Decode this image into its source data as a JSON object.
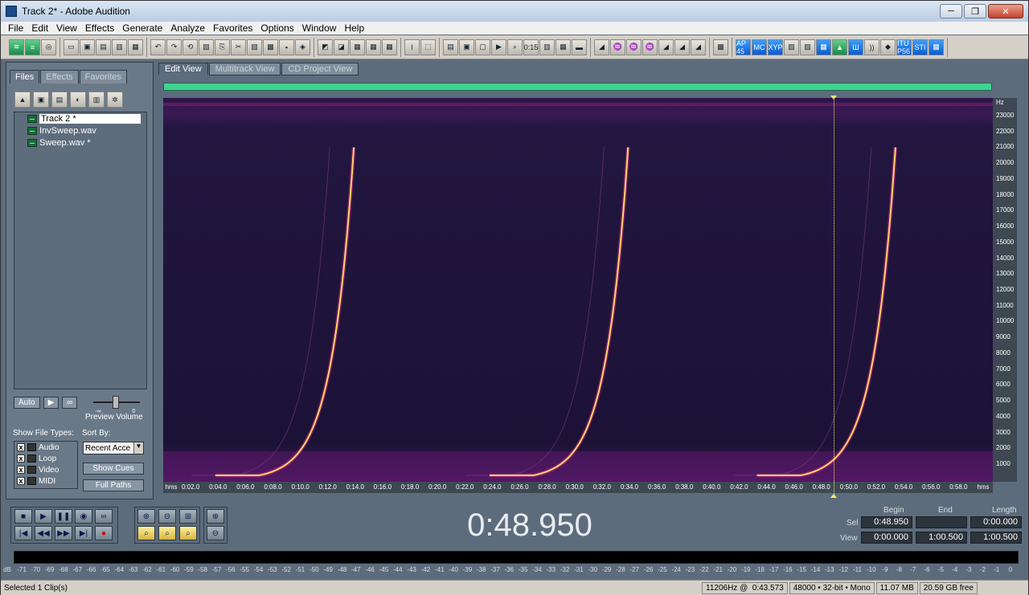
{
  "window": {
    "title": "Track 2* - Adobe Audition",
    "minimize": "─",
    "restore": "❐",
    "close": "✕"
  },
  "menu": [
    {
      "label": "File"
    },
    {
      "label": "Edit"
    },
    {
      "label": "View"
    },
    {
      "label": "Effects"
    },
    {
      "label": "Generate"
    },
    {
      "label": "Analyze"
    },
    {
      "label": "Favorites"
    },
    {
      "label": "Options"
    },
    {
      "label": "Window"
    },
    {
      "label": "Help"
    }
  ],
  "toolbar_right_icons": [
    "AP 45",
    "MC",
    "XYP",
    "",
    "",
    "",
    "",
    "",
    "",
    "",
    "ITU P56",
    "STI",
    ""
  ],
  "panel": {
    "tabs": [
      "Files",
      "Effects",
      "Favorites"
    ],
    "files": [
      "Track 2 *",
      "InvSweep.wav",
      "Sweep.wav *"
    ],
    "auto": "Auto",
    "preview_volume": "Preview Volume",
    "slider_min": "-∞",
    "slider_max": "0",
    "show_file_types": "Show File Types:",
    "sort_by": "Sort By:",
    "sort_value": "Recent Acce",
    "types": [
      {
        "label": "Audio",
        "checked": true
      },
      {
        "label": "Loop",
        "checked": true
      },
      {
        "label": "Video",
        "checked": true
      },
      {
        "label": "MIDI",
        "checked": true
      }
    ],
    "show_cues": "Show Cues",
    "full_paths": "Full Paths"
  },
  "view_tabs": [
    "Edit View",
    "Multitrack View",
    "CD Project View"
  ],
  "spectrum": {
    "hz_unit": "Hz",
    "hz_ticks": [
      "23000",
      "22000",
      "21000",
      "20000",
      "19000",
      "18000",
      "17000",
      "16000",
      "15000",
      "14000",
      "13000",
      "12000",
      "11000",
      "10000",
      "9000",
      "8000",
      "7000",
      "6000",
      "5000",
      "4000",
      "3000",
      "2000",
      "1000"
    ],
    "time_unit": "hms",
    "time_ticks": [
      "0:02.0",
      "0:04.0",
      "0:06.0",
      "0:08.0",
      "0:10.0",
      "0:12.0",
      "0:14.0",
      "0:16.0",
      "0:18.0",
      "0:20.0",
      "0:22.0",
      "0:24.0",
      "0:26.0",
      "0:28.0",
      "0:30.0",
      "0:32.0",
      "0:34.0",
      "0:36.0",
      "0:38.0",
      "0:40.0",
      "0:42.0",
      "0:44.0",
      "0:46.0",
      "0:48.0",
      "0:50.0",
      "0:52.0",
      "0:54.0",
      "0:56.0",
      "0:58.0"
    ],
    "sweep_starts": [
      3.8,
      23.8,
      43.3
    ],
    "duration": 60.5,
    "cursor_time": 48.95
  },
  "time_display": "0:48.950",
  "selection": {
    "headers": [
      "Begin",
      "End",
      "Length"
    ],
    "sel_label": "Sel",
    "view_label": "View",
    "sel": [
      "0:48.950",
      "",
      "0:00.000"
    ],
    "view": [
      "0:00.000",
      "1:00.500",
      "1:00.500"
    ]
  },
  "meter": {
    "unit": "dB",
    "labels": [
      "-71",
      "-70",
      "-69",
      "-68",
      "-67",
      "-66",
      "-65",
      "-64",
      "-63",
      "-62",
      "-61",
      "-60",
      "-59",
      "-58",
      "-57",
      "-56",
      "-55",
      "-54",
      "-53",
      "-52",
      "-51",
      "-50",
      "-49",
      "-48",
      "-47",
      "-46",
      "-45",
      "-44",
      "-43",
      "-42",
      "-41",
      "-40",
      "-39",
      "-38",
      "-37",
      "-36",
      "-35",
      "-34",
      "-33",
      "-32",
      "-31",
      "-30",
      "-29",
      "-28",
      "-27",
      "-26",
      "-25",
      "-24",
      "-23",
      "-22",
      "-21",
      "-20",
      "-19",
      "-18",
      "-17",
      "-16",
      "-15",
      "-14",
      "-13",
      "-12",
      "-11",
      "-10",
      "-9",
      "-8",
      "-7",
      "-6",
      "-5",
      "-4",
      "-3",
      "-2",
      "-1",
      "0"
    ]
  },
  "status": {
    "selected": "Selected 1 Clip(s)",
    "freq": "11206Hz @",
    "time": "0:43.573",
    "format": "48000 • 32-bit • Mono",
    "size": "11.07 MB",
    "free": "20.59 GB free"
  }
}
